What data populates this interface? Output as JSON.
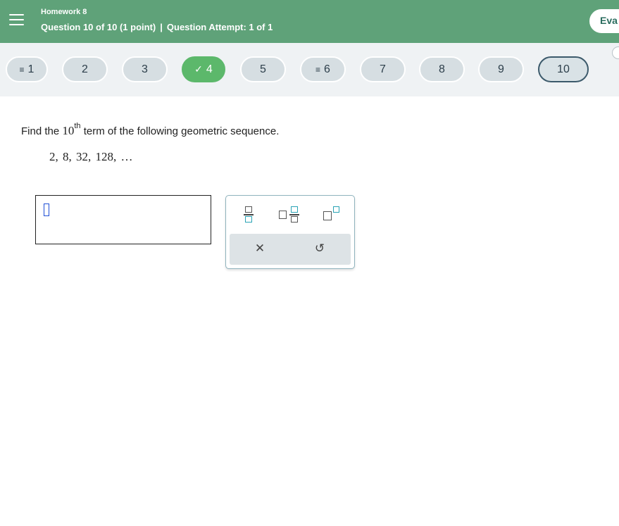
{
  "header": {
    "homework_title": "Homework 8",
    "question_info": "Question 10 of 10 (1 point)",
    "separator": "|",
    "attempt_info": "Question Attempt: 1 of 1",
    "evaluate_label": "Eva"
  },
  "nav": {
    "questions": [
      {
        "label": "1",
        "prefix": "≡"
      },
      {
        "label": "2",
        "prefix": ""
      },
      {
        "label": "3",
        "prefix": ""
      },
      {
        "label": "4",
        "prefix": "✓"
      },
      {
        "label": "5",
        "prefix": ""
      },
      {
        "label": "6",
        "prefix": "≡"
      },
      {
        "label": "7",
        "prefix": ""
      },
      {
        "label": "8",
        "prefix": ""
      },
      {
        "label": "9",
        "prefix": ""
      },
      {
        "label": "10",
        "prefix": ""
      }
    ],
    "completed_question": "4",
    "current_question": "10"
  },
  "question": {
    "prompt_before": "Find the",
    "term_number": "10",
    "term_suffix": "th",
    "prompt_after": "term of the following geometric sequence.",
    "sequence": "2, 8, 32, 128, …"
  },
  "answer": {
    "value": ""
  },
  "palette": {
    "tools": [
      "fraction-icon",
      "mixed-number-icon",
      "exponent-icon"
    ],
    "clear_icon": "✕",
    "undo_icon": "↺"
  },
  "colors": {
    "header_bg": "#5fa279",
    "nav_bg": "#eff2f4",
    "done_green": "#5cb86b",
    "accent_teal": "#29a3b5"
  }
}
